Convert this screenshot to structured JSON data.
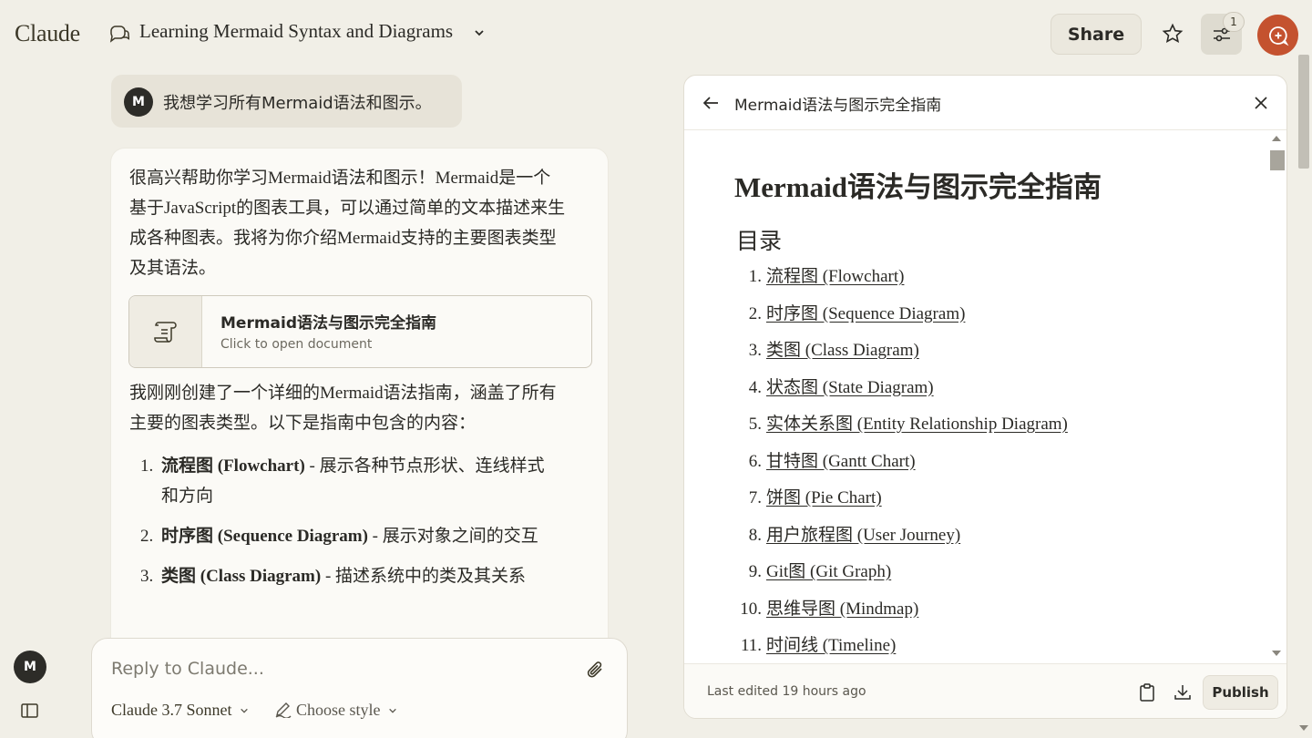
{
  "app": {
    "logo": "Claude"
  },
  "header": {
    "conversation_title": "Learning Mermaid Syntax and Diagrams",
    "share_label": "Share",
    "notification_count": "1",
    "colors": {
      "accent": "#c4522f"
    }
  },
  "user_message": {
    "avatar_initial": "M",
    "text": "我想学习所有Mermaid语法和图示。"
  },
  "assistant_message": {
    "intro": "很高兴帮助你学习Mermaid语法和图示！Mermaid是一个基于JavaScript的图表工具，可以通过简单的文本描述来生成各种图表。我将为你介绍Mermaid支持的主要图表类型及其语法。",
    "doc_card": {
      "title": "Mermaid语法与图示完全指南",
      "subtitle": "Click to open document"
    },
    "para2": "我刚刚创建了一个详细的Mermaid语法指南，涵盖了所有主要的图表类型。以下是指南中包含的内容：",
    "items": [
      {
        "num": "1.",
        "bold": "流程图 (Flowchart)",
        "rest": " - 展示各种节点形状、连线样式和方向"
      },
      {
        "num": "2.",
        "bold": "时序图 (Sequence Diagram)",
        "rest": " - 展示对象之间的交互"
      },
      {
        "num": "3.",
        "bold": "类图 (Class Diagram)",
        "rest": " - 描述系统中的类及其关系"
      }
    ]
  },
  "reply": {
    "placeholder": "Reply to Claude...",
    "model": "Claude 3.7 Sonnet",
    "style": "Choose style"
  },
  "sidebar": {
    "avatar_initial": "M"
  },
  "document": {
    "header_title": "Mermaid语法与图示完全指南",
    "h1": "Mermaid语法与图示完全指南",
    "toc_heading": "目录",
    "toc": [
      {
        "num": "1.",
        "label": "流程图 (Flowchart)"
      },
      {
        "num": "2.",
        "label": "时序图 (Sequence Diagram)"
      },
      {
        "num": "3.",
        "label": "类图 (Class Diagram)"
      },
      {
        "num": "4.",
        "label": "状态图 (State Diagram)"
      },
      {
        "num": "5.",
        "label": "实体关系图 (Entity Relationship Diagram)"
      },
      {
        "num": "6.",
        "label": "甘特图 (Gantt Chart)"
      },
      {
        "num": "7.",
        "label": "饼图 (Pie Chart)"
      },
      {
        "num": "8.",
        "label": "用户旅程图 (User Journey)"
      },
      {
        "num": "9.",
        "label": "Git图 (Git Graph)"
      },
      {
        "num": "10.",
        "label": "思维导图 (Mindmap)"
      },
      {
        "num": "11.",
        "label": "时间线 (Timeline)"
      }
    ],
    "last_edited": "Last edited 19 hours ago",
    "publish_label": "Publish"
  }
}
